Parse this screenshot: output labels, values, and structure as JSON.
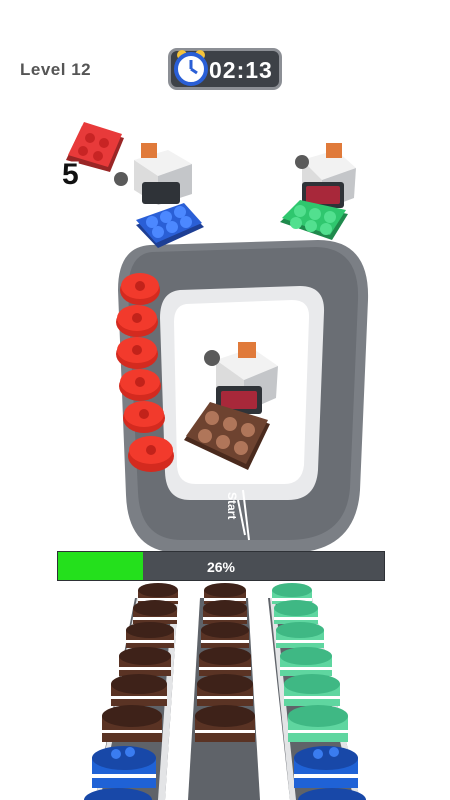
{
  "hud": {
    "level_label": "Level 12",
    "timer": "02:13",
    "tray_count": "5"
  },
  "track": {
    "start_label": "Start"
  },
  "progress": {
    "percent_label": "26%",
    "fraction": 0.26
  },
  "colors": {
    "green": "#24e01c",
    "red_tray": "#e83a3a",
    "blue_tray": "#2a5fd6",
    "green_tray": "#2fc76e",
    "brown_tray": "#6e4330",
    "conveyor": "#5f6369"
  },
  "icons": [
    "alarm-clock-icon",
    "cake-machine-icon",
    "tray-icon",
    "cake-icon"
  ]
}
